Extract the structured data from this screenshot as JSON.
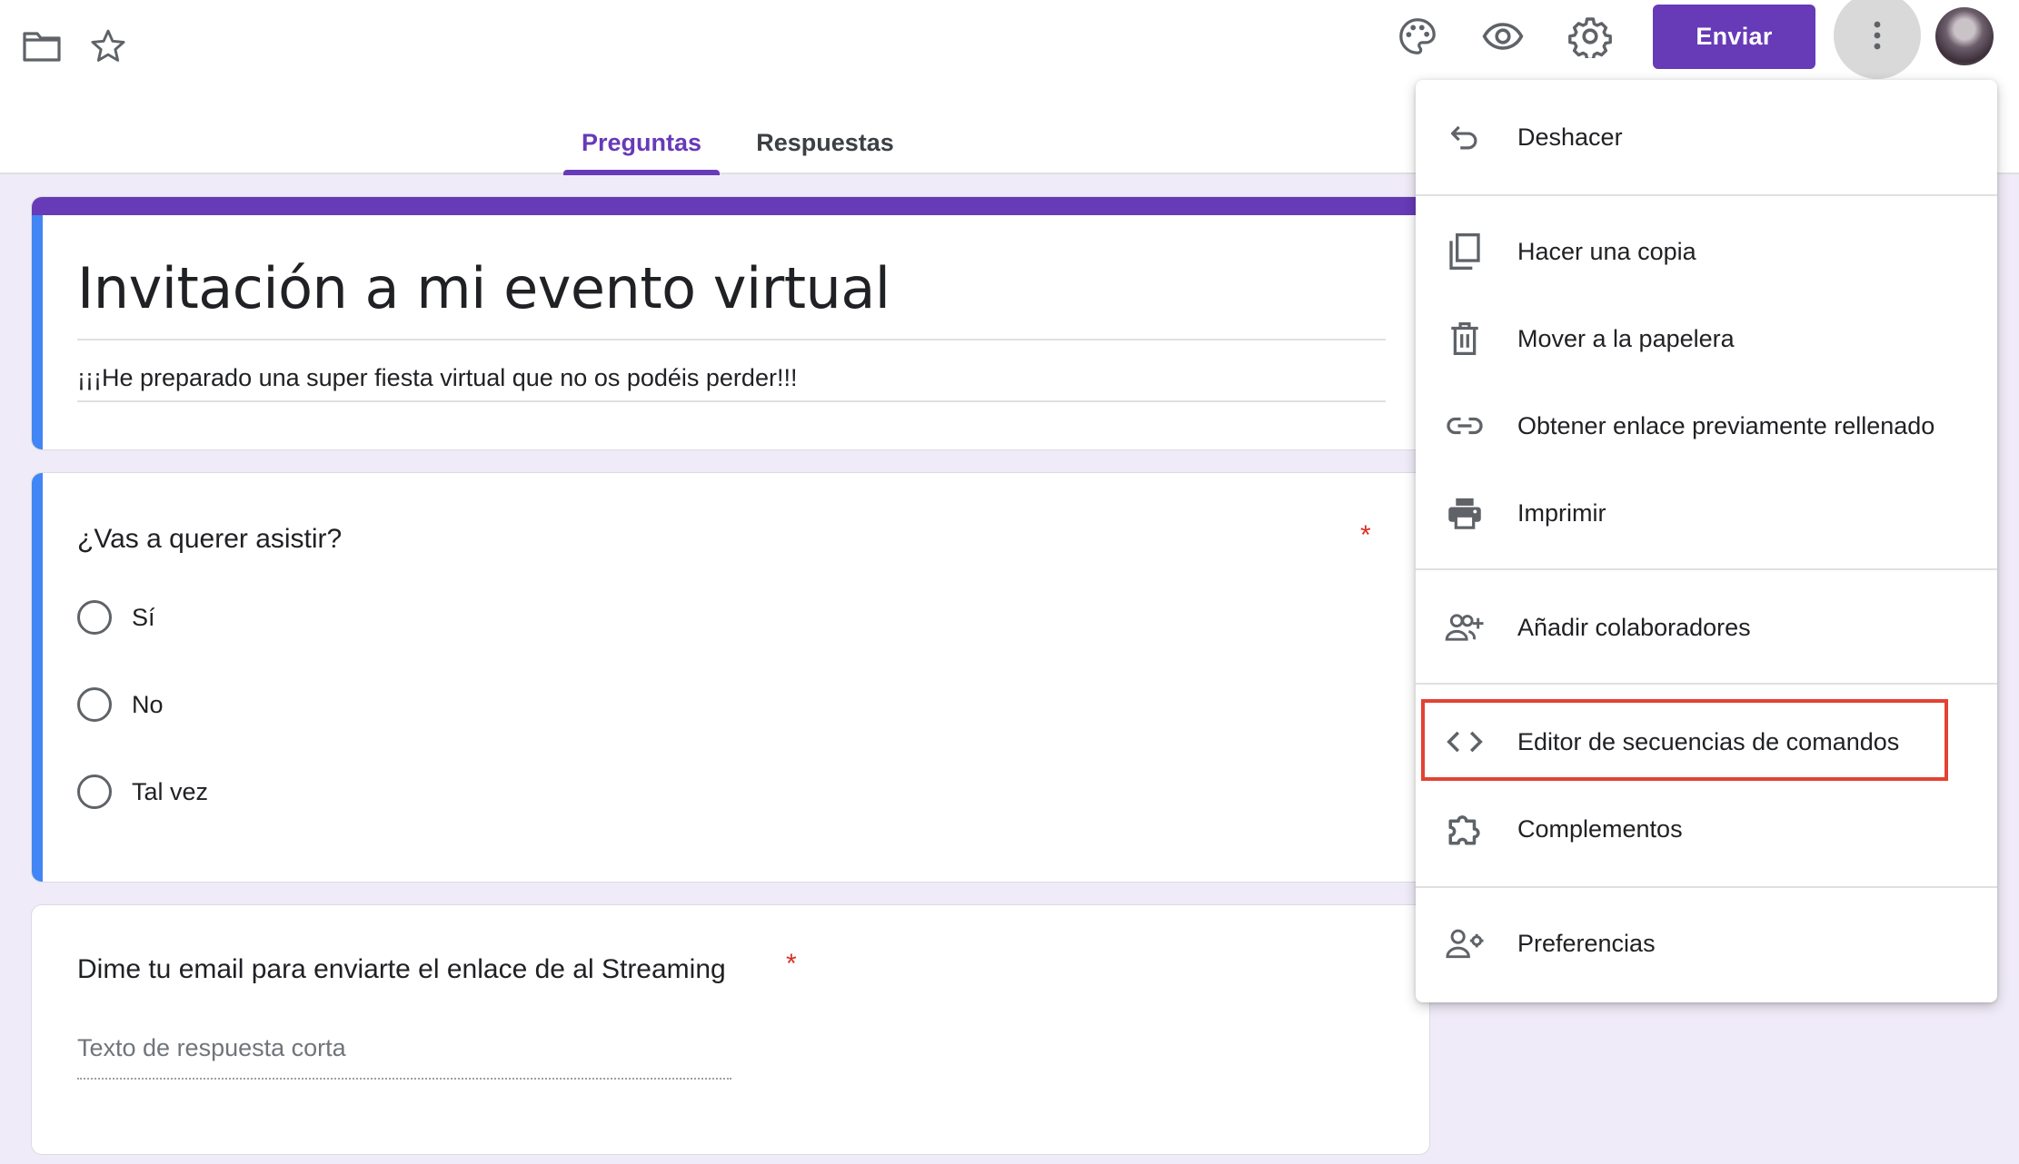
{
  "colors": {
    "accent": "#673ab7",
    "highlight": "#e34234",
    "required": "#d93025",
    "left_strip": "#4285f4",
    "background": "#f0ebf8"
  },
  "header": {
    "icons": [
      "folder-icon",
      "star-icon",
      "palette-icon",
      "eye-icon",
      "gear-icon"
    ],
    "send_label": "Enviar",
    "more_icon": "more-vert-icon"
  },
  "tabs": [
    {
      "label": "Preguntas",
      "active": true
    },
    {
      "label": "Respuestas",
      "active": false
    }
  ],
  "form": {
    "title": "Invitación a mi evento virtual",
    "description": "¡¡¡He preparado una super fiesta virtual que no os podéis perder!!!"
  },
  "questions": [
    {
      "title": "¿Vas a querer asistir?",
      "required_mark": "*",
      "options": [
        "Sí",
        "No",
        "Tal vez"
      ]
    },
    {
      "title": "Dime tu email para enviarte el enlace de al Streaming",
      "required_mark": "*",
      "placeholder": "Texto de respuesta corta"
    }
  ],
  "menu": {
    "items": [
      {
        "label": "Deshacer",
        "icon": "undo-icon"
      },
      {
        "label": "Hacer una copia",
        "icon": "copy-icon"
      },
      {
        "label": "Mover a la papelera",
        "icon": "trash-icon"
      },
      {
        "label": "Obtener enlace previamente rellenado",
        "icon": "link-icon"
      },
      {
        "label": "Imprimir",
        "icon": "print-icon"
      },
      {
        "label": "Añadir colaboradores",
        "icon": "add-people-icon"
      },
      {
        "label": "Editor de secuencias de comandos",
        "icon": "code-icon",
        "highlighted": true
      },
      {
        "label": "Complementos",
        "icon": "puzzle-icon"
      },
      {
        "label": "Preferencias",
        "icon": "person-settings-icon"
      }
    ]
  }
}
